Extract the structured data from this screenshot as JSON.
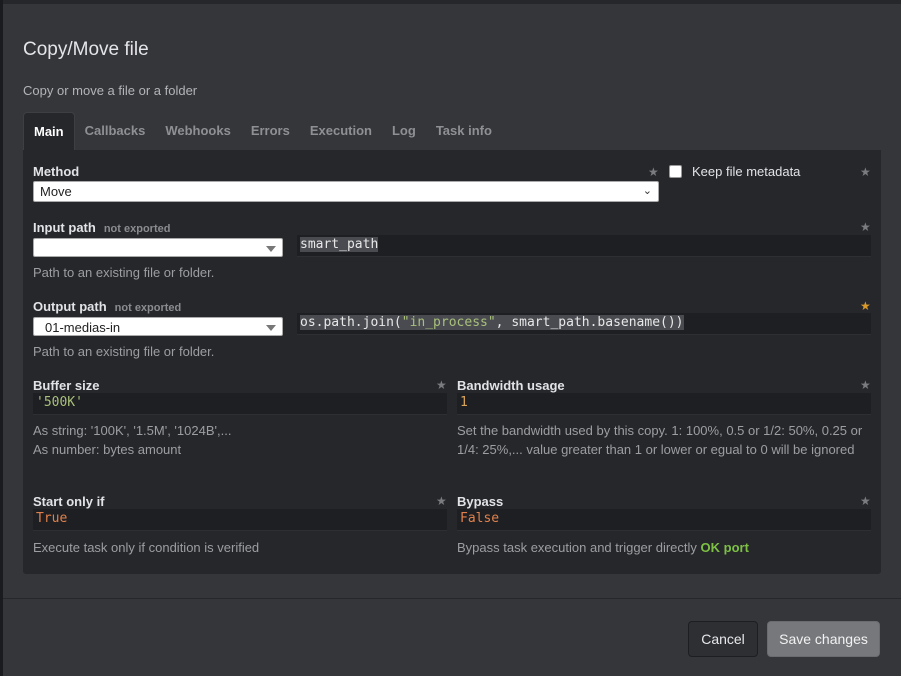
{
  "dialog": {
    "title": "Copy/Move file",
    "subtitle": "Copy or move a file or a folder"
  },
  "tabs": [
    {
      "label": "Main",
      "active": true
    },
    {
      "label": "Callbacks"
    },
    {
      "label": "Webhooks"
    },
    {
      "label": "Errors"
    },
    {
      "label": "Execution"
    },
    {
      "label": "Log"
    },
    {
      "label": "Task info"
    }
  ],
  "method": {
    "label": "Method",
    "value": "Move",
    "keep_metadata_label": "Keep file metadata",
    "keep_metadata_checked": false
  },
  "input_path": {
    "label": "Input path",
    "badge": "not exported",
    "select_value": "",
    "code": "smart_path",
    "help": "Path to an existing file or folder."
  },
  "output_path": {
    "label": "Output path",
    "badge": "not exported",
    "select_value": "01-medias-in",
    "code_prefix": "os.path.join(",
    "code_string": "\"in_process\"",
    "code_suffix": ", smart_path.basename())",
    "help": "Path to an existing file or folder.",
    "starred": true
  },
  "buffer_size": {
    "label": "Buffer size",
    "value": "'500K'",
    "help_line1": "As string: '100K', '1.5M', '1024B',...",
    "help_line2": "As number: bytes amount"
  },
  "bandwidth": {
    "label": "Bandwidth usage",
    "value": "1",
    "help": "Set the bandwidth used by this copy. 1: 100%, 0.5 or 1/2: 50%, 0.25 or 1/4: 25%,...  value greater than 1 or lower or egual to 0 will be ignored"
  },
  "start_only_if": {
    "label": "Start only if",
    "value": "True",
    "help": "Execute task only if condition is verified"
  },
  "bypass": {
    "label": "Bypass",
    "value": "False",
    "help_text": "Bypass task execution and trigger directly ",
    "help_highlight": "OK port"
  },
  "footer": {
    "cancel": "Cancel",
    "save": "Save changes"
  },
  "colors": {
    "accent_star": "#d99a2c",
    "ok_port": "#7cc043"
  }
}
